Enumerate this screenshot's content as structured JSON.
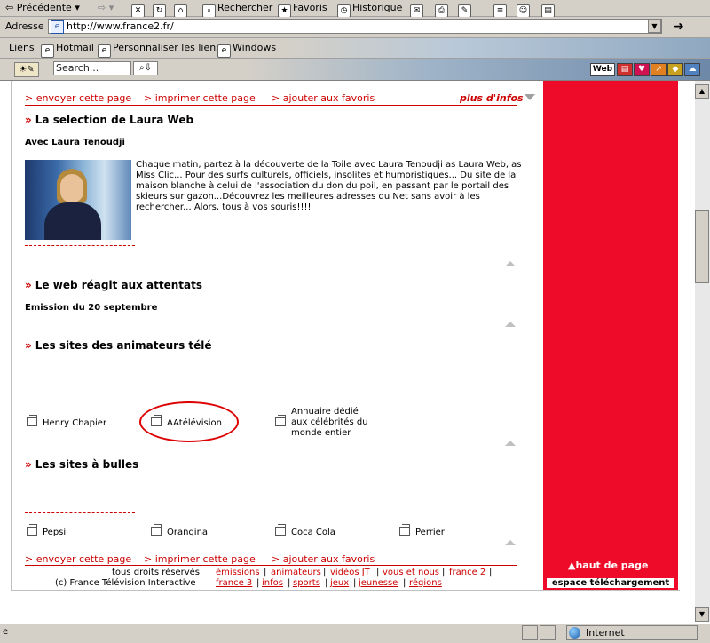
{
  "browser": {
    "toolbar": {
      "back_label": "Précédente",
      "search_label": "Rechercher",
      "favorites_label": "Favoris",
      "history_label": "Historique"
    },
    "address": {
      "label": "Adresse",
      "url": "http://www.france2.fr/"
    },
    "links": {
      "label": "Liens",
      "items": [
        "Hotmail",
        "Personnaliser les liens",
        "Windows"
      ]
    },
    "searchbar": {
      "placeholder": "Search...",
      "web_label": "Web"
    },
    "status": {
      "zone_label": "Internet"
    }
  },
  "page": {
    "top_actions": {
      "send": "> envoyer cette page",
      "print": "> imprimer cette page",
      "favorites": "> ajouter aux favoris",
      "more_info": "plus d'infos"
    },
    "sections": [
      {
        "title": "La selection de Laura Web",
        "subtitle": "Avec Laura Tenoudji",
        "description": "Chaque matin, partez à la découverte de la Toile avec Laura Tenoudji as Laura Web, as Miss Clic... Pour des surfs culturels, officiels, insolites et humoristiques... Du site de la maison blanche à celui de l'association du don du poil, en passant par le portail des skieurs sur gazon...Découvrez les meilleures adresses du Net sans avoir à les rechercher... Alors, tous à vos souris!!!!"
      },
      {
        "title": "Le web réagit aux attentats",
        "subtitle": "Emission du 20 septembre"
      },
      {
        "title": "Les sites des animateurs télé",
        "items": [
          "Henry Chapier",
          "AAtélévision",
          "Annuaire dédié aux célébrités du monde entier"
        ]
      },
      {
        "title": "Les sites à bulles",
        "items": [
          "Pepsi",
          "Orangina",
          "Coca Cola",
          "Perrier"
        ]
      }
    ],
    "bottom_actions": {
      "send": "> envoyer cette page",
      "print": "> imprimer cette page",
      "favorites": "> ajouter aux favoris"
    },
    "footer": {
      "rights": "tous droits réservés",
      "copyright": "(c) France Télévision Interactive",
      "links_row1": [
        "émissions",
        "animateurs",
        "vidéos JT",
        "vous et nous",
        "france 2"
      ],
      "links_row2": [
        "france 3",
        "infos",
        "sports",
        "jeux",
        "jeunesse",
        "régions"
      ]
    },
    "right_panel": {
      "top_of_page": "haut de page",
      "download_space": "espace téléchargement"
    },
    "colors": {
      "brand_red": "#ee0b2a",
      "link_red": "#cc0000",
      "annotation_red": "#dd0000"
    }
  }
}
